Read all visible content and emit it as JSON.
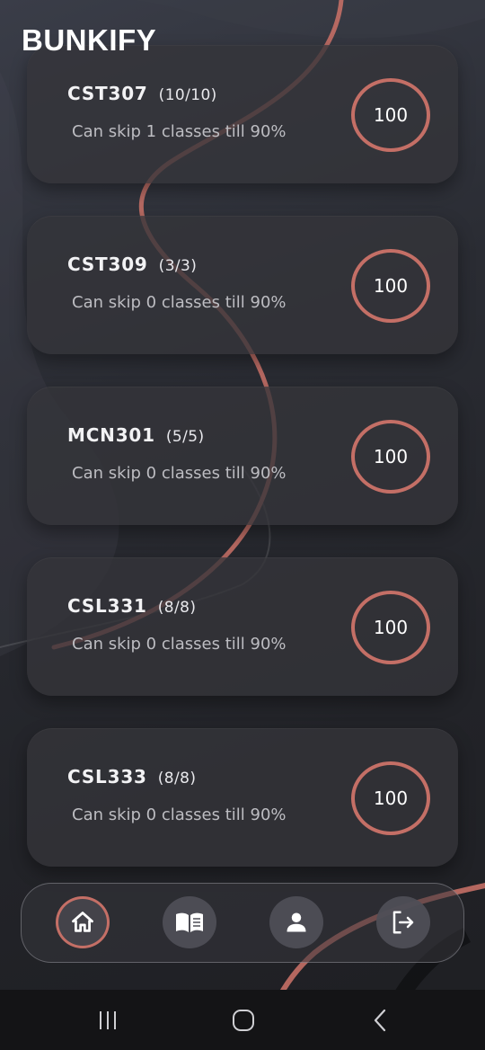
{
  "app": {
    "title": "BUNKIFY"
  },
  "courses": [
    {
      "code": "CST307",
      "count": "(10/10)",
      "skip": "Can skip 1 classes till 90%",
      "percent": "100"
    },
    {
      "code": "CST309",
      "count": "(3/3)",
      "skip": "Can skip 0 classes till 90%",
      "percent": "100"
    },
    {
      "code": "MCN301",
      "count": "(5/5)",
      "skip": "Can skip 0 classes till 90%",
      "percent": "100"
    },
    {
      "code": "CSL331",
      "count": "(8/8)",
      "skip": "Can skip 0 classes till 90%",
      "percent": "100"
    },
    {
      "code": "CSL333",
      "count": "(8/8)",
      "skip": "Can skip 0 classes till 90%",
      "percent": "100"
    }
  ],
  "nav": {
    "items": [
      {
        "icon": "home-icon",
        "active": true
      },
      {
        "icon": "book-icon",
        "active": false
      },
      {
        "icon": "person-icon",
        "active": false
      },
      {
        "icon": "logout-icon",
        "active": false
      }
    ]
  },
  "system_nav": {
    "icons": [
      "recent-apps-icon",
      "home-circle-icon",
      "back-icon"
    ]
  },
  "colors": {
    "accent": "#c46f66",
    "card": "#34343a",
    "background": "#222328"
  }
}
